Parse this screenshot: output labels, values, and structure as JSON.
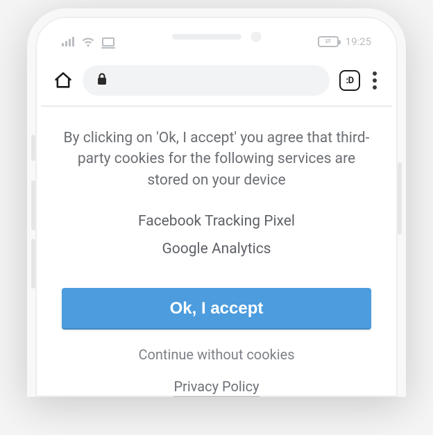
{
  "statusbar": {
    "time": "19:25"
  },
  "browser": {
    "tab_badge": ":D"
  },
  "cookie_consent": {
    "message": "By clicking on 'Ok, I accept' you agree that third-party cookies for the following services are stored on your device",
    "services": [
      "Facebook Tracking Pixel",
      "Google Analytics"
    ],
    "accept_label": "Ok, I accept",
    "continue_label": "Continue without cookies",
    "privacy_label": "Privacy Policy"
  },
  "colors": {
    "accent": "#4c9cde",
    "text_muted": "#6a6d72"
  }
}
